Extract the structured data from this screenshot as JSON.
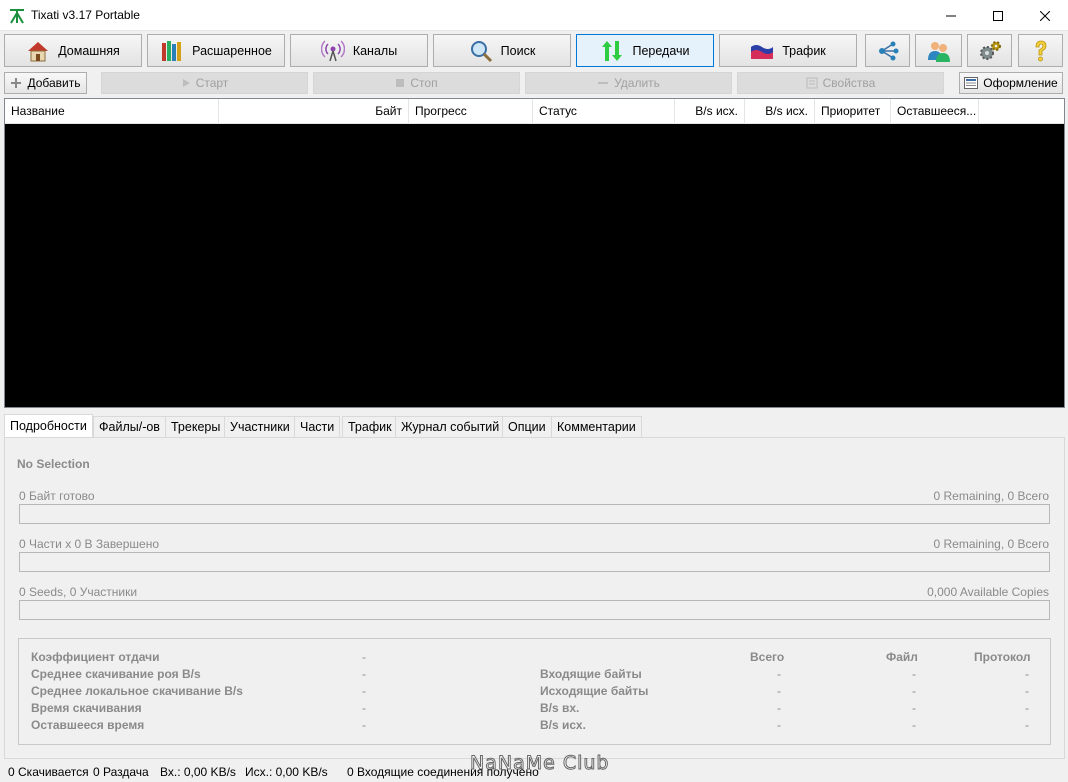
{
  "window": {
    "title": "Tixati v3.17 Portable"
  },
  "main_toolbar": [
    {
      "label": "Домашняя",
      "icon": "home-icon"
    },
    {
      "label": "Расшаренное",
      "icon": "books-icon"
    },
    {
      "label": "Каналы",
      "icon": "channels-icon"
    },
    {
      "label": "Поиск",
      "icon": "magnifier-icon"
    },
    {
      "label": "Передачи",
      "icon": "transfers-arrows-icon",
      "active": true
    },
    {
      "label": "Трафик",
      "icon": "traffic-icon"
    },
    {
      "label": "",
      "icon": "network-icon"
    },
    {
      "label": "",
      "icon": "peers-icon"
    },
    {
      "label": "",
      "icon": "settings-gears-icon"
    },
    {
      "label": "",
      "icon": "help-question-icon"
    }
  ],
  "sub_toolbar": {
    "add": "Добавить",
    "start": "Старт",
    "stop": "Стоп",
    "delete": "Удалить",
    "properties": "Свойства",
    "design": "Оформление"
  },
  "columns": [
    "Название",
    "Байт",
    "Прогресс",
    "Статус",
    "B/s исх.",
    "B/s исх.",
    "Приоритет",
    "Оставшееся..."
  ],
  "tabs": [
    "Подробности",
    "Файлы/-ов",
    "Трекеры",
    "Участники",
    "Части",
    "Трафик",
    "Журнал событий",
    "Опции",
    "Комментарии"
  ],
  "details": {
    "no_selection": "No Selection",
    "bytes_ready": "0 Байт готово",
    "bytes_remaining": "0 Remaining,  0 Всего",
    "pieces": "0 Части  x  0 В Завершено",
    "pieces_remaining": "0 Remaining,  0 Всего",
    "seeds": "0 Seeds, 0 Участники",
    "copies": "0,000 Available Copies"
  },
  "stats": {
    "left_labels": [
      "Коэффициент отдачи",
      "Среднее скачивание роя B/s",
      "Среднее локальное скачивание B/s",
      "Время скачивания",
      "Оставшееся время"
    ],
    "left_values": [
      "-",
      "-",
      "-",
      "-",
      "-"
    ],
    "right_headers": [
      "Всего",
      "Файл",
      "Протокол"
    ],
    "right_labels": [
      "Входящие байты",
      "Исходящие байты",
      "B/s вх.",
      "B/s исх."
    ],
    "dash": "-"
  },
  "status_bar": {
    "downloading": "0 Скачивается",
    "seeding": "0 Раздача",
    "in": "Вх.: 0,00 KB/s",
    "out": "Исх.: 0,00 KB/s",
    "incoming": "0 Входящие соединения получено"
  },
  "watermark": "NaNaMe Club",
  "colors": {
    "accent": "#0078d7",
    "list_background": "#000000",
    "disabled_text": "#a0a0a0",
    "label_gray": "#8a8a8a"
  }
}
